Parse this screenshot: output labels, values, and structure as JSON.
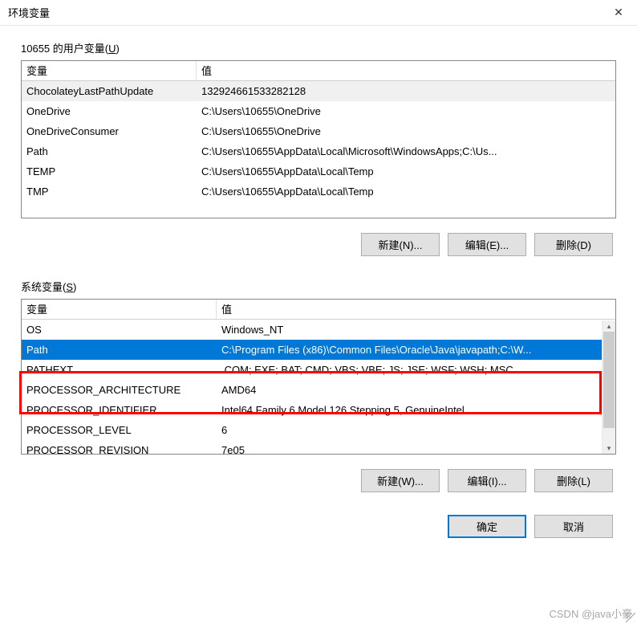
{
  "window": {
    "title": "环境变量",
    "close": "✕"
  },
  "userVars": {
    "label_pre": "10655 的用户变量(",
    "label_u": "U",
    "label_post": ")",
    "header_var": "变量",
    "header_val": "值",
    "rows": [
      {
        "var": "ChocolateyLastPathUpdate",
        "val": "132924661533282128"
      },
      {
        "var": "OneDrive",
        "val": "C:\\Users\\10655\\OneDrive"
      },
      {
        "var": "OneDriveConsumer",
        "val": "C:\\Users\\10655\\OneDrive"
      },
      {
        "var": "Path",
        "val": "C:\\Users\\10655\\AppData\\Local\\Microsoft\\WindowsApps;C:\\Us..."
      },
      {
        "var": "TEMP",
        "val": "C:\\Users\\10655\\AppData\\Local\\Temp"
      },
      {
        "var": "TMP",
        "val": "C:\\Users\\10655\\AppData\\Local\\Temp"
      }
    ],
    "btn_new": "新建(N)...",
    "btn_edit": "编辑(E)...",
    "btn_del": "删除(D)"
  },
  "sysVars": {
    "label_pre": "系统变量(",
    "label_u": "S",
    "label_post": ")",
    "header_var": "变量",
    "header_val": "值",
    "rows": [
      {
        "var": "OS",
        "val": "Windows_NT"
      },
      {
        "var": "Path",
        "val": "C:\\Program Files (x86)\\Common Files\\Oracle\\Java\\javapath;C:\\W..."
      },
      {
        "var": "PATHEXT",
        "val": ".COM;.EXE;.BAT;.CMD;.VBS;.VBE;.JS;.JSE;.WSF;.WSH;.MSC"
      },
      {
        "var": "PROCESSOR_ARCHITECTURE",
        "val": "AMD64"
      },
      {
        "var": "PROCESSOR_IDENTIFIER",
        "val": "Intel64 Family 6 Model 126 Stepping 5, GenuineIntel"
      },
      {
        "var": "PROCESSOR_LEVEL",
        "val": "6"
      },
      {
        "var": "PROCESSOR_REVISION",
        "val": "7e05"
      }
    ],
    "btn_new": "新建(W)...",
    "btn_edit": "编辑(I)...",
    "btn_del": "删除(L)"
  },
  "footer": {
    "ok": "确定",
    "cancel": "取消"
  },
  "watermark": "CSDN @java小豪"
}
